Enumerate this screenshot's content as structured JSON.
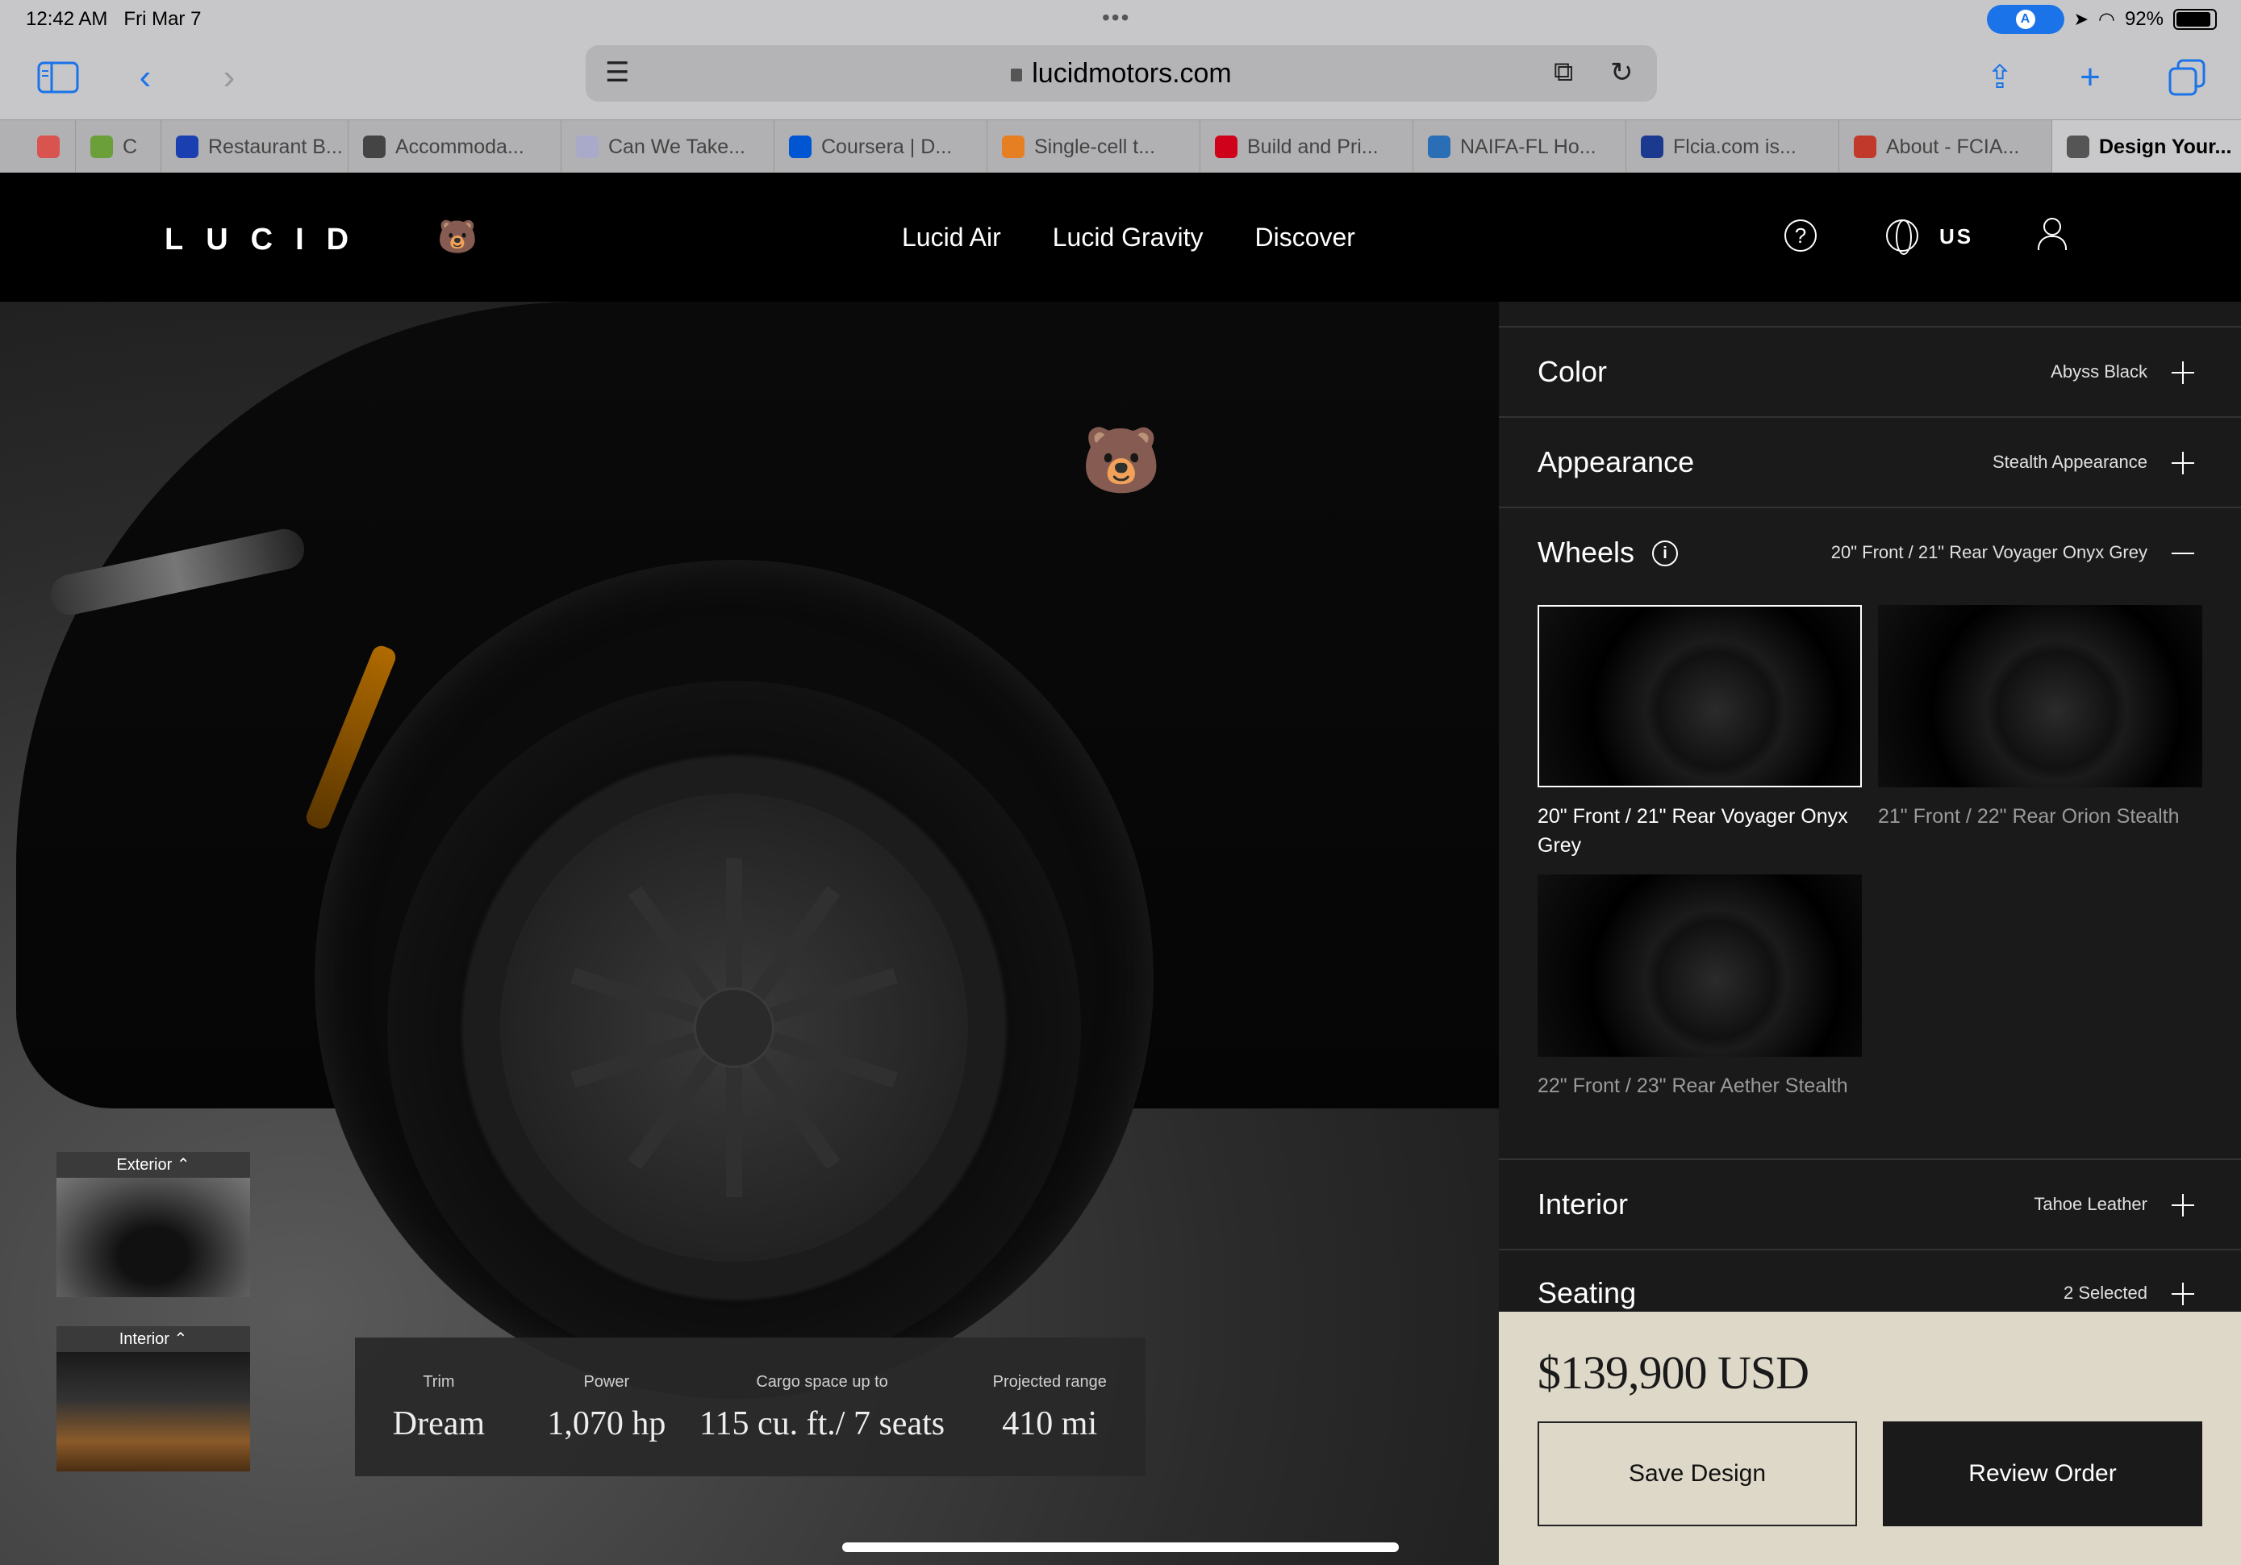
{
  "status_bar": {
    "time": "12:42 AM",
    "date": "Fri Mar 7",
    "dots": "•••",
    "battery": "92%"
  },
  "browser": {
    "url": "lucidmotors.com",
    "tabs": [
      {
        "label": "",
        "color": "#d9534f"
      },
      {
        "label": "C",
        "color": "#6a9f3a"
      },
      {
        "label": "Restaurant B...",
        "color": "#1a3fb0"
      },
      {
        "label": "Accommoda...",
        "color": "#444444"
      },
      {
        "label": "Can We Take...",
        "color": "#a9a9c9"
      },
      {
        "label": "Coursera | D...",
        "color": "#0056d2"
      },
      {
        "label": "Single-cell t...",
        "color": "#e67e22"
      },
      {
        "label": "Build and Pri...",
        "color": "#d0021b"
      },
      {
        "label": "NAIFA-FL Ho...",
        "color": "#2a6fb5"
      },
      {
        "label": "Flcia.com is...",
        "color": "#1b3a8f"
      },
      {
        "label": "About - FCIA...",
        "color": "#c0392b"
      },
      {
        "label": "Design Your...",
        "color": "#555555"
      }
    ]
  },
  "site": {
    "logo": "LUCID",
    "nav": [
      "Lucid Air",
      "Lucid Gravity",
      "Discover"
    ],
    "region": "US"
  },
  "views": {
    "exterior": "Exterior",
    "interior": "Interior"
  },
  "specs": [
    {
      "label": "Trim",
      "value": "Dream"
    },
    {
      "label": "Power",
      "value": "1,070 hp"
    },
    {
      "label": "Cargo space up to",
      "value": "115 cu. ft./ 7 seats"
    },
    {
      "label": "Projected range",
      "value": "410 mi"
    }
  ],
  "config": {
    "color": {
      "title": "Color",
      "value": "Abyss Black"
    },
    "appearance": {
      "title": "Appearance",
      "value": "Stealth Appearance"
    },
    "wheels": {
      "title": "Wheels",
      "value": "20\" Front / 21\" Rear Voyager Onyx Grey",
      "options": [
        {
          "name": "20\" Front / 21\" Rear Voyager Onyx Grey"
        },
        {
          "name": "21\" Front / 22\" Rear Orion Stealth"
        },
        {
          "name": "22\" Front / 23\" Rear Aether Stealth"
        }
      ]
    },
    "interior": {
      "title": "Interior",
      "value": "Tahoe Leather"
    },
    "seating": {
      "title": "Seating",
      "value": "2 Selected"
    }
  },
  "price": "$139,900 USD",
  "actions": {
    "save": "Save Design",
    "review": "Review Order"
  }
}
